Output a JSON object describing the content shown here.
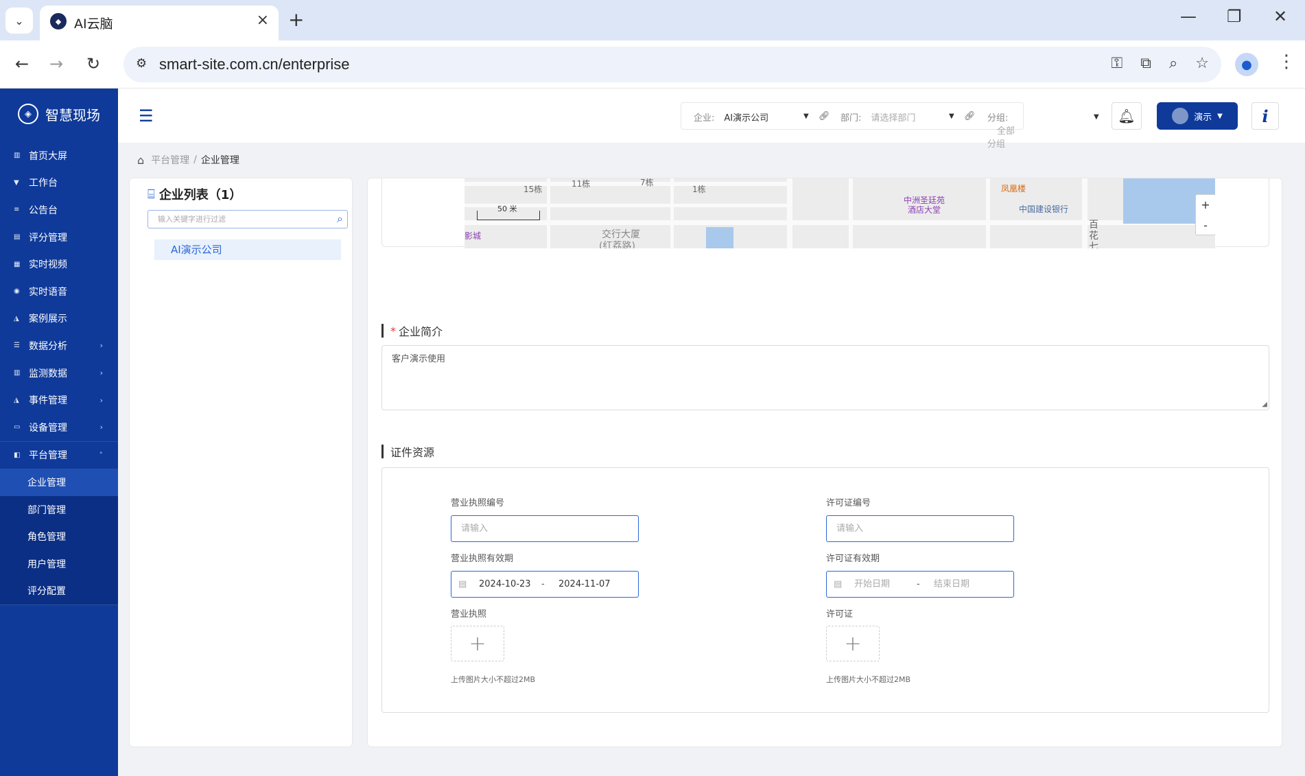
{
  "browser": {
    "tab_title": "AI云脑",
    "url": "smart-site.com.cn/enterprise"
  },
  "app": {
    "logo_text": "智慧现场"
  },
  "sidebar": {
    "items": [
      {
        "label": "首页大屏"
      },
      {
        "label": "工作台"
      },
      {
        "label": "公告台"
      },
      {
        "label": "评分管理"
      },
      {
        "label": "实时视频"
      },
      {
        "label": "实时语音"
      },
      {
        "label": "案例展示"
      },
      {
        "label": "数据分析"
      },
      {
        "label": "监测数据"
      },
      {
        "label": "事件管理"
      },
      {
        "label": "设备管理"
      },
      {
        "label": "平台管理"
      }
    ],
    "submenu": [
      {
        "label": "企业管理"
      },
      {
        "label": "部门管理"
      },
      {
        "label": "角色管理"
      },
      {
        "label": "用户管理"
      },
      {
        "label": "评分配置"
      }
    ]
  },
  "header": {
    "company_label": "企业:",
    "company_value": "AI演示公司",
    "dept_label": "部门:",
    "dept_placeholder": "请选择部门",
    "group_label": "分组:",
    "group_value": "全部分组",
    "user_label": "演示"
  },
  "breadcrumb": {
    "parent": "平台管理",
    "separator": "/",
    "current": "企业管理"
  },
  "left_panel": {
    "title": "企业列表（1）",
    "search_placeholder": "输入关键字进行过滤",
    "companies": [
      "AI演示公司"
    ]
  },
  "map": {
    "labels": [
      "15栋",
      "11栋",
      "7栋",
      "1栋",
      "交行大厦",
      "(红荔路)",
      "影城",
      "中洲圣廷苑",
      "酒店大堂",
      "凤凰楼",
      "中国建设银行",
      "百",
      "花",
      "七"
    ],
    "scale": "50 米",
    "zoom_in": "+",
    "zoom_out": "-"
  },
  "intro": {
    "required_mark": "*",
    "title": "企业简介",
    "value": "客户演示使用"
  },
  "certificates": {
    "title": "证件资源",
    "license_no_label": "营业执照编号",
    "license_no_placeholder": "请输入",
    "permit_no_label": "许可证编号",
    "permit_no_placeholder": "请输入",
    "license_valid_label": "营业执照有效期",
    "license_start": "2024-10-23",
    "license_end": "2024-11-07",
    "date_sep": "-",
    "permit_valid_label": "许可证有效期",
    "permit_start_placeholder": "开始日期",
    "permit_end_placeholder": "结束日期",
    "license_img_label": "营业执照",
    "permit_img_label": "许可证",
    "upload_hint": "上传图片大小不超过2MB"
  }
}
